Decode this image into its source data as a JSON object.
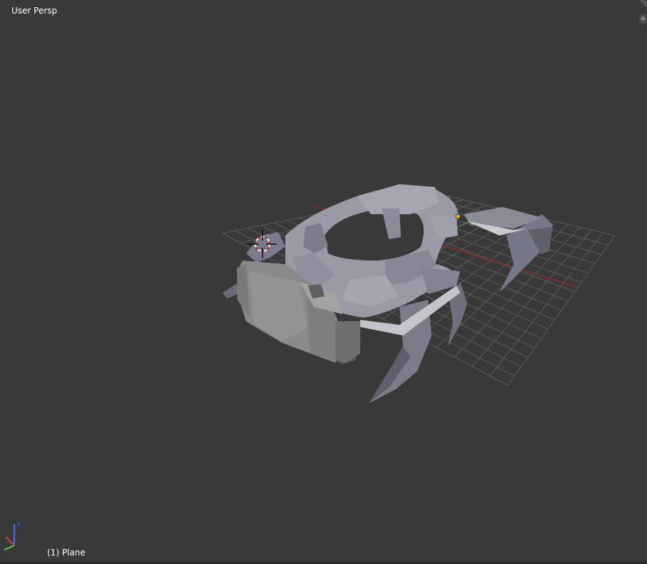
{
  "viewport": {
    "view_name": "User Persp",
    "object_info": "(1) Plane",
    "region_toggle_glyph": "+"
  },
  "gizmo": {
    "z_label": "z",
    "x_color": "#d23c3c",
    "y_color": "#4fd24f",
    "z_color": "#4a6cf0"
  },
  "colors": {
    "background": "#393939",
    "grid": "#5c5c5c",
    "x_axis": "#a02828",
    "y_axis": "#3f8f3f",
    "mesh_light": "#9a9aa6",
    "mesh_dark": "#5e5e6c",
    "origin_dot": "#f0a040"
  },
  "icons": [
    "3d-cursor-icon",
    "axis-gizmo-icon",
    "origin-dot-icon",
    "region-plus-icon"
  ]
}
